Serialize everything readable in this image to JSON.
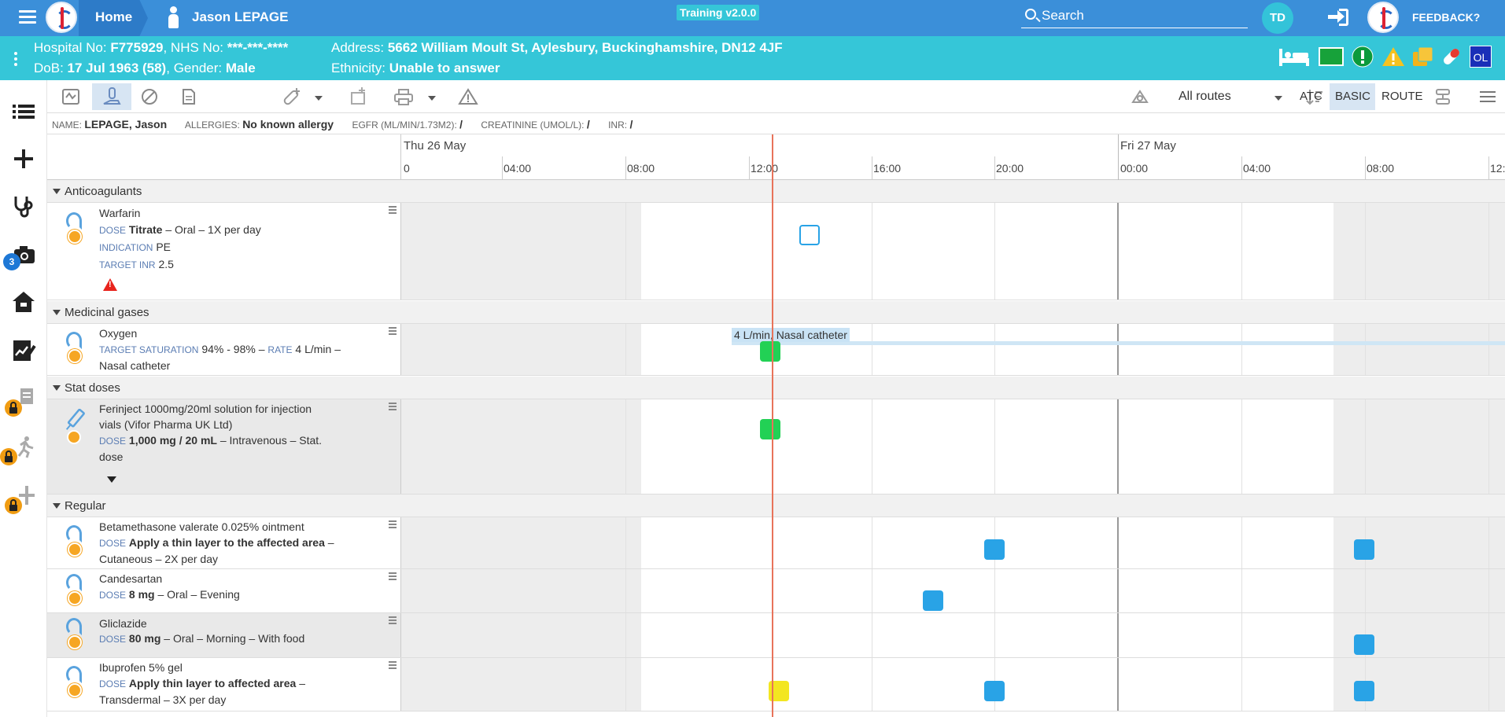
{
  "topbar": {
    "home_label": "Home",
    "patient_name": "Jason LEPAGE",
    "training_label": "Training v2.0.0",
    "search_placeholder": "Search",
    "user_initials": "TD",
    "feedback_label": "FEEDBACK?"
  },
  "patient_banner": {
    "hospital_no_label": "Hospital No:",
    "hospital_no": "F775929",
    "nhs_no_label": "NHS No:",
    "nhs_no": "***-***-****",
    "dob_label": "DoB:",
    "dob": "17 Jul 1963 (58)",
    "gender_label": "Gender:",
    "gender": "Male",
    "address_label": "Address:",
    "address": "5662 William Moult St, Aylesbury, Buckinghamshire, DN12 4JF",
    "ethnicity_label": "Ethnicity:",
    "ethnicity": "Unable to answer",
    "ol_badge": "OL"
  },
  "sidebar": {
    "camera_badge": "3"
  },
  "toolbar": {
    "routes_label": "All routes",
    "atc_label": "ATC",
    "basic_label": "BASIC",
    "route_label": "ROUTE"
  },
  "infobar": {
    "name_label": "NAME:",
    "name": "LEPAGE, Jason",
    "allergies_label": "ALLERGIES:",
    "allergies": "No known allergy",
    "egfr_label": "EGFR (ML/MIN/1.73M2):",
    "egfr": "/",
    "creatinine_label": "CREATININE (UMOL/L):",
    "creatinine": "/",
    "inr_label": "INR:",
    "inr": "/"
  },
  "timeline": {
    "day1": "Thu 26 May",
    "day2": "Fri 27 May",
    "hours": [
      "0",
      "04:00",
      "08:00",
      "12:00",
      "16:00",
      "20:00",
      "00:00",
      "04:00",
      "08:00",
      "12:"
    ]
  },
  "sections": {
    "anticoagulants": "Anticoagulants",
    "gases": "Medicinal gases",
    "stat": "Stat doses",
    "regular": "Regular"
  },
  "labels": {
    "dose": "DOSE",
    "indication": "INDICATION",
    "target_inr": "TARGET INR",
    "target_saturation": "TARGET SATURATION",
    "rate": "RATE"
  },
  "meds": {
    "warfarin": {
      "name": "Warfarin",
      "dose": "Titrate",
      "detail": " – Oral – 1X per day",
      "indication": "PE",
      "target_inr": "2.5"
    },
    "oxygen": {
      "name": "Oxygen",
      "saturation": "94% - 98%",
      "sep": " – ",
      "rate": "4 L/min",
      "detail": " –",
      "detail2": "Nasal catheter",
      "bar_label": "4 L/min, Nasal catheter"
    },
    "ferinject": {
      "name": "Ferinject 1000mg/20ml solution for injection",
      "name2": "vials (Vifor Pharma UK Ltd)",
      "dose": "1,000 mg / 20 mL",
      "detail": " – Intravenous – Stat.",
      "detail2": "dose"
    },
    "betamethasone": {
      "name": "Betamethasone valerate 0.025% ointment",
      "dose": "Apply a thin layer to the affected area",
      "detail": " –",
      "detail2": "Cutaneous – 2X per day"
    },
    "candesartan": {
      "name": "Candesartan",
      "dose": "8 mg",
      "detail": " – Oral – Evening"
    },
    "gliclazide": {
      "name": "Gliclazide",
      "dose": "80 mg",
      "detail": " – Oral – Morning – With food"
    },
    "ibuprofen": {
      "name": "Ibuprofen 5% gel",
      "dose": "Apply thin layer to affected area",
      "detail": " –",
      "detail2": "Transdermal – 3X per day"
    }
  }
}
